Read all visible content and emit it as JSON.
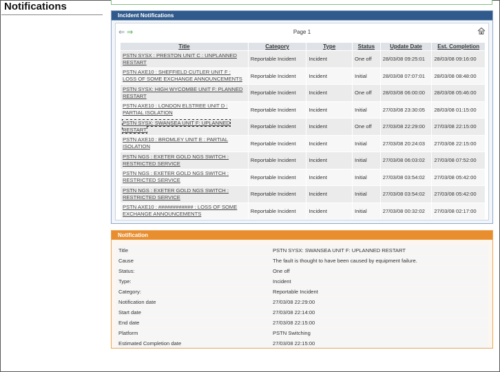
{
  "page": {
    "title": "Notifications"
  },
  "incidents_panel": {
    "header": "Incident Notifications",
    "page_label": "Page 1",
    "columns": [
      "Title",
      "Category",
      "Type",
      "Status",
      "Update Date",
      "Est. Completion"
    ],
    "rows": [
      {
        "title": "PSTN SYSX : PRESTON UNIT C : UNPLANNED RESTART",
        "category": "Reportable Incident",
        "type": "Incident",
        "status": "One off",
        "update": "28/03/08 09:25:01",
        "completion": "28/03/08 09:16:00"
      },
      {
        "title": "PSTN AXE10 : SHEFFIELD CUTLER UNIT F : LOSS OF SOME EXCHANGE ANNOUNCEMENTS",
        "category": "Reportable Incident",
        "type": "Incident",
        "status": "Initial",
        "update": "28/03/08 07:07:01",
        "completion": "28/03/08 08:48:00"
      },
      {
        "title": "PSTN SYSX: HIGH WYCOMBE UNIT F: PLANNED RESTART",
        "category": "Reportable Incident",
        "type": "Incident",
        "status": "One off",
        "update": "28/03/08 06:00:00",
        "completion": "28/03/08 05:46:00"
      },
      {
        "title": "PSTN AXE10 : LONDON ELSTREE UNIT D : PARTIAL ISOLATION",
        "category": "Reportable Incident",
        "type": "Incident",
        "status": "Initial",
        "update": "27/03/08 23:30:05",
        "completion": "28/03/08 01:15:00"
      },
      {
        "title": "PSTN SYSX: SWANSEA UNIT F: UPLANNED RESTART",
        "category": "Reportable Incident",
        "type": "Incident",
        "status": "One off",
        "update": "27/03/08 22:29:00",
        "completion": "27/03/08 22:15:00"
      },
      {
        "title": "PSTN AXE10 : BROMLEY UNIT E : PARTIAL ISOLATION",
        "category": "Reportable Incident",
        "type": "Incident",
        "status": "Initial",
        "update": "27/03/08 20:24:03",
        "completion": "27/03/08 22:15:00"
      },
      {
        "title": "PSTN NGS : EXETER GOLD NGS SWITCH : RESTRICTED SERVICE",
        "category": "Reportable Incident",
        "type": "Incident",
        "status": "Initial",
        "update": "27/03/08 06:03:02",
        "completion": "27/03/08 07:52:00"
      },
      {
        "title": "PSTN NGS : EXETER GOLD NGS SWITCH : RESTRICTED SERVICE",
        "category": "Reportable Incident",
        "type": "Incident",
        "status": "Initial",
        "update": "27/03/08 03:54:02",
        "completion": "27/03/08 05:42:00"
      },
      {
        "title": "PSTN NGS : EXETER GOLD NGS SWITCH : RESTRICTED SERVICE",
        "category": "Reportable Incident",
        "type": "Incident",
        "status": "Initial",
        "update": "27/03/08 03:54:02",
        "completion": "27/03/08 05:42:00"
      },
      {
        "title": "PSTN AXE10 : ############ : LOSS OF SOME EXCHANGE ANNOUNCEMENTS",
        "category": "Reportable Incident",
        "type": "Incident",
        "status": "Initial",
        "update": "27/03/08 00:32:02",
        "completion": "27/03/08 02:17:00"
      }
    ]
  },
  "detail_panel": {
    "header": "Notification",
    "fields": [
      {
        "label": "Title",
        "value": "PSTN SYSX: SWANSEA UNIT F: UPLANNED RESTART"
      },
      {
        "label": "Cause",
        "value": "The fault is thought to have been caused by equipment failure."
      },
      {
        "label": "Status:",
        "value": "One off"
      },
      {
        "label": "Type:",
        "value": "Incident"
      },
      {
        "label": "Category:",
        "value": "Reportable Incident"
      },
      {
        "label": "Notification date",
        "value": "27/03/08 22:29:00"
      },
      {
        "label": "Start date",
        "value": "27/03/08 22:14:00"
      },
      {
        "label": "End date",
        "value": "27/03/08 22:15:00"
      },
      {
        "label": "Platform",
        "value": "PSTN Switching"
      },
      {
        "label": "Estimated Completion date",
        "value": "27/03/08 22:15:00"
      }
    ]
  },
  "icons": {
    "prev": "arrow-left-icon",
    "next": "arrow-right-icon",
    "home": "home-icon"
  },
  "colors": {
    "blue_header": "#305a8c",
    "orange_header": "#e88e2e",
    "next_arrow": "#44a844"
  }
}
